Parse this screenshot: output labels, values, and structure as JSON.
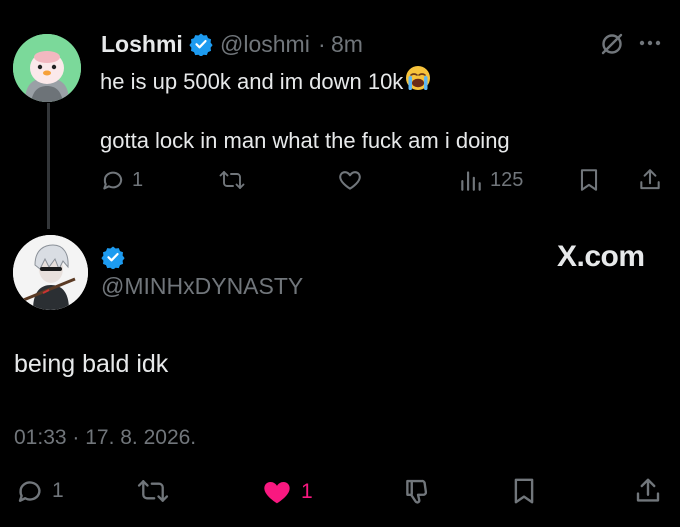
{
  "tweet": {
    "display_name": "Loshmi",
    "handle": "@loshmi",
    "separator": "·",
    "time": "8m",
    "text_line1": "he is up 500k and im down 10k",
    "text_line2": "gotta lock in man what the fuck am i doing",
    "replies": "1",
    "views": "125"
  },
  "reply": {
    "handle": "@MINHxDYNASTY",
    "watermark": "X.com",
    "text": "being bald idk",
    "timestamp": "01:33 · 17. 8. 2026.",
    "replies": "1",
    "likes": "1"
  },
  "colors": {
    "background": "#000000",
    "text": "#e7e9ea",
    "muted": "#71767b",
    "verified": "#1d9bf0",
    "like": "#f91880"
  }
}
